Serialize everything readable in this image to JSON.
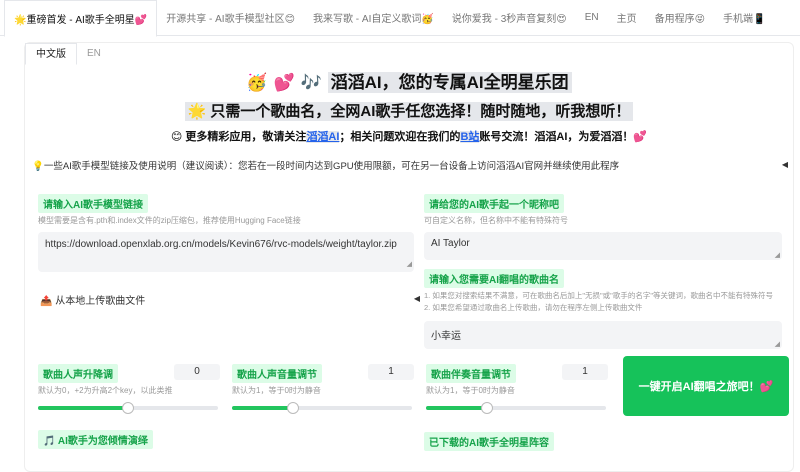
{
  "nav": {
    "tabs": [
      {
        "label": "🌟重磅首发 - AI歌手全明星💕",
        "active": true
      },
      {
        "label": "开源共享 - AI歌手模型社区😊",
        "active": false
      },
      {
        "label": "我来写歌 - AI自定义歌词🥳",
        "active": false
      },
      {
        "label": "说你爱我 - 3秒声音复刻😍",
        "active": false
      },
      {
        "label": "EN",
        "active": false
      },
      {
        "label": "主页",
        "active": false
      },
      {
        "label": "备用程序😝",
        "active": false
      },
      {
        "label": "手机端📱",
        "active": false
      }
    ]
  },
  "subtabs": [
    {
      "label": "中文版",
      "active": true
    },
    {
      "label": "EN",
      "active": false
    }
  ],
  "header": {
    "title_prefix": "🥳 💕 🎶 ",
    "title": "滔滔AI，您的专属AI全明星乐团",
    "subtitle": "🌟 只需一个歌曲名，全网AI歌手任您选择！随时随地，听我想听！",
    "note_a": "😊 更多精彩应用，敬请关注",
    "note_link1": "滔滔AI",
    "note_b": "；相关问题欢迎在我们的",
    "note_link2": "B站",
    "note_c": "账号交流！滔滔AI，为爱滔滔！💕"
  },
  "accordion": {
    "text": "💡一些AI歌手模型链接及使用说明（建议阅读）：您若在一段时间内达到GPU使用限额，可在另一台设备上访问滔滔AI官网并继续使用此程序",
    "caret": "◀"
  },
  "model_link": {
    "label": "请输入AI歌手模型链接",
    "hint": "模型需要是含有.pth和.index文件的zip压缩包，推荐使用Hugging Face链接",
    "value": "https://download.openxlab.org.cn/models/Kevin676/rvc-models/weight/taylor.zip"
  },
  "nickname": {
    "label": "请给您的AI歌手起一个昵称吧",
    "hint": "可自定义名称，但名称中不能有特殊符号",
    "value": "AI Taylor"
  },
  "song_name": {
    "label": "请输入您需要AI翻唱的歌曲名",
    "hint1": "1. 如果您对搜索结果不满意，可在歌曲名后加上\"无损\"或\"歌手的名字\"等关键词，歌曲名中不能有特殊符号",
    "hint2": "2. 如果您希望通过歌曲名上传歌曲，请勿在程序左侧上传歌曲文件",
    "value": "小幸运"
  },
  "upload": {
    "label": "📤 从本地上传歌曲文件",
    "caret": "◀"
  },
  "sliders": [
    {
      "label": "歌曲人声升降调",
      "hint": "默认为0，+2为升高2个key，以此类推",
      "value": "0",
      "fraction": 0.5
    },
    {
      "label": "歌曲人声音量调节",
      "hint": "默认为1，等于0时为静音",
      "value": "1",
      "fraction": 0.34
    },
    {
      "label": "歌曲伴奏音量调节",
      "hint": "默认为1，等于0时为静音",
      "value": "1",
      "fraction": 0.34
    }
  ],
  "action": {
    "label": "一键开启AI翻唱之旅吧！💕"
  },
  "bottom": {
    "left_label": "🎵 AI歌手为您倾情演绎",
    "right_label": "已下载的AI歌手全明星阵容"
  }
}
